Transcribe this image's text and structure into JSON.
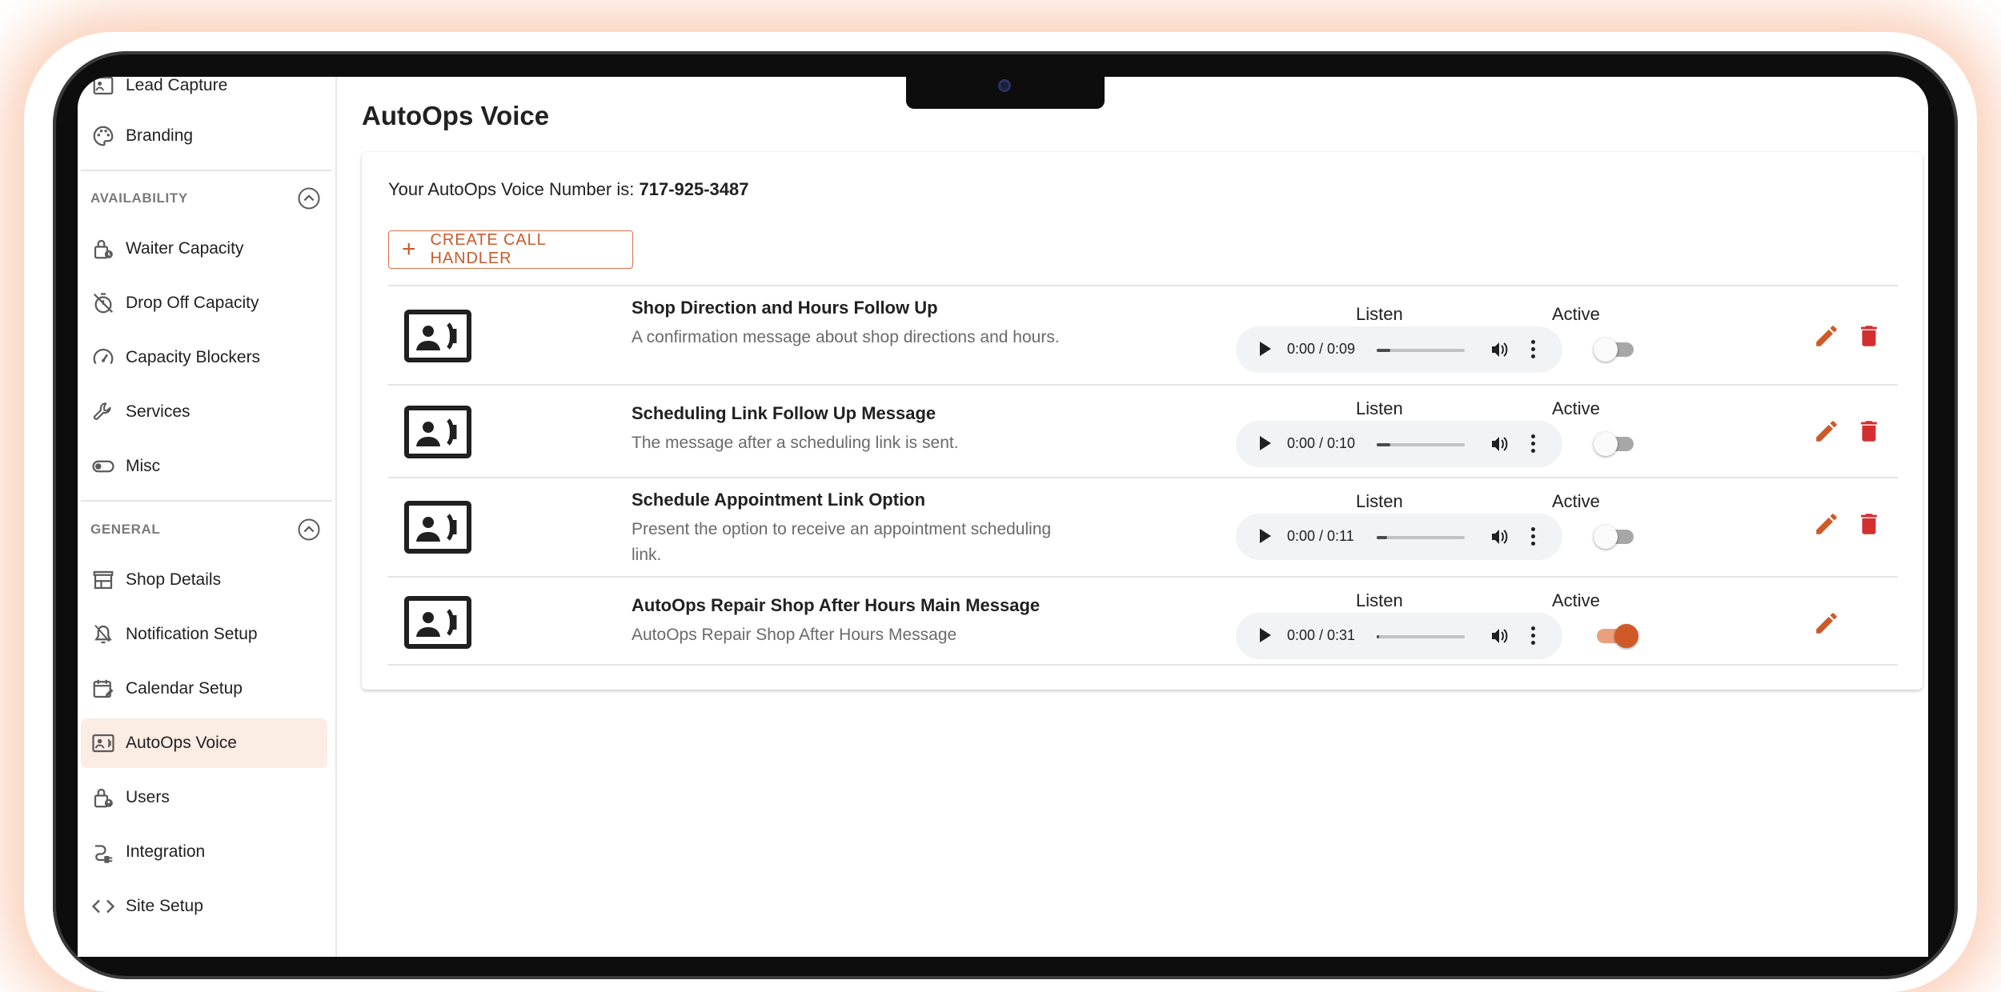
{
  "sidebar": {
    "top_items": [
      {
        "label": "Lead Capture",
        "icon": "lead-capture-icon"
      },
      {
        "label": "Branding",
        "icon": "palette-icon"
      }
    ],
    "sections": [
      {
        "title": "AVAILABILITY",
        "items": [
          {
            "label": "Waiter Capacity",
            "icon": "lock-clock-icon"
          },
          {
            "label": "Drop Off Capacity",
            "icon": "timer-off-icon"
          },
          {
            "label": "Capacity Blockers",
            "icon": "speed-icon"
          },
          {
            "label": "Services",
            "icon": "wrench-icon"
          },
          {
            "label": "Misc",
            "icon": "toggle-icon"
          }
        ]
      },
      {
        "title": "GENERAL",
        "items": [
          {
            "label": "Shop Details",
            "icon": "storefront-icon"
          },
          {
            "label": "Notification Setup",
            "icon": "notification-icon"
          },
          {
            "label": "Calendar Setup",
            "icon": "calendar-edit-icon"
          },
          {
            "label": "AutoOps Voice",
            "icon": "contact-phone-icon",
            "active": true
          },
          {
            "label": "Users",
            "icon": "lock-person-icon"
          },
          {
            "label": "Integration",
            "icon": "plug-icon"
          },
          {
            "label": "Site Setup",
            "icon": "code-icon"
          }
        ]
      }
    ]
  },
  "page": {
    "title": "AutoOps Voice",
    "voice_number_label": "Your AutoOps Voice Number is:",
    "voice_number": "717-925-3487",
    "create_button": "CREATE CALL HANDLER",
    "listen_label": "Listen",
    "active_label": "Active"
  },
  "handlers": [
    {
      "title": "Shop Direction and Hours Follow Up",
      "description": "A confirmation message about shop directions and hours.",
      "time": "0:00 / 0:09",
      "progress": 0.15,
      "active": false,
      "deletable": true
    },
    {
      "title": "Scheduling Link Follow Up Message",
      "description": "The message after a scheduling link is sent.",
      "time": "0:00 / 0:10",
      "progress": 0.15,
      "active": false,
      "deletable": true
    },
    {
      "title": "Schedule Appointment Link Option",
      "description": "Present the option to receive an appointment scheduling link.",
      "time": "0:00 / 0:11",
      "progress": 0.12,
      "active": false,
      "deletable": true
    },
    {
      "title": "AutoOps Repair Shop After Hours Main Message",
      "description": "AutoOps Repair Shop After Hours Message",
      "time": "0:00 / 0:31",
      "progress": 0.03,
      "active": true,
      "deletable": false
    }
  ],
  "colors": {
    "accent": "#cf5a28",
    "delete": "#d32f2f",
    "active_bg": "#fbece4"
  }
}
